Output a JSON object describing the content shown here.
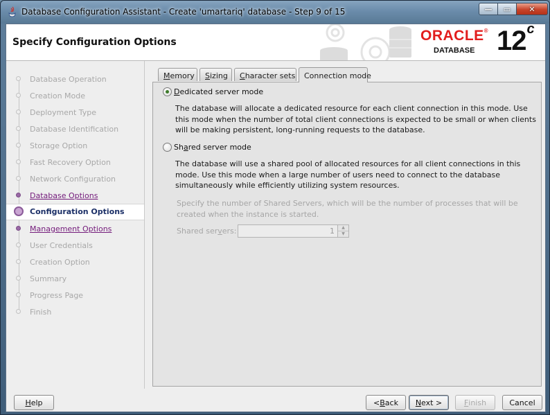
{
  "window": {
    "title": "Database Configuration Assistant - Create 'umartariq' database - Step 9 of 15",
    "controls": {
      "minimize": "—",
      "maximize": "▭",
      "close": "✕"
    }
  },
  "header": {
    "page_title": "Specify Configuration Options",
    "logo": {
      "brand": "ORACLE",
      "reg": "®",
      "product": "DATABASE",
      "version": "12",
      "version_suffix": "c"
    }
  },
  "nav": {
    "items": [
      {
        "label": "Database Operation",
        "state": "disabled"
      },
      {
        "label": "Creation Mode",
        "state": "disabled"
      },
      {
        "label": "Deployment Type",
        "state": "disabled"
      },
      {
        "label": "Database Identification",
        "state": "disabled"
      },
      {
        "label": "Storage Option",
        "state": "disabled"
      },
      {
        "label": "Fast Recovery Option",
        "state": "disabled"
      },
      {
        "label": "Network Configuration",
        "state": "disabled"
      },
      {
        "label": "Database Options",
        "state": "visited"
      },
      {
        "label": "Configuration Options",
        "state": "current"
      },
      {
        "label": "Management Options",
        "state": "visited"
      },
      {
        "label": "User Credentials",
        "state": "disabled"
      },
      {
        "label": "Creation Option",
        "state": "disabled"
      },
      {
        "label": "Summary",
        "state": "disabled"
      },
      {
        "label": "Progress Page",
        "state": "disabled"
      },
      {
        "label": "Finish",
        "state": "disabled"
      }
    ]
  },
  "tabs": [
    {
      "pre": "",
      "mn": "M",
      "post": "emory"
    },
    {
      "pre": "",
      "mn": "S",
      "post": "izing"
    },
    {
      "pre": "",
      "mn": "C",
      "post": "haracter sets"
    },
    {
      "pre": "Connection mode",
      "mn": "",
      "post": ""
    }
  ],
  "selected_tab": "Connection mode",
  "connection_mode": {
    "selected": "dedicated",
    "dedicated": {
      "pre": "",
      "mn": "D",
      "post": "edicated server mode",
      "description": "The database will allocate a dedicated resource for each client connection in this mode. Use this mode when the number of total client connections is expected to be small or when clients will be making persistent, long-running requests to the database."
    },
    "shared": {
      "pre": "Sh",
      "mn": "a",
      "post": "red server mode",
      "description": "The database will use a shared pool of allocated resources for all client connections in this mode.  Use this mode when a large number of users need to connect to the database simultaneously while efficiently utilizing system resources."
    },
    "shared_servers_note": "Specify the number of Shared Servers, which will be the number of processes that will be created when the instance is started.",
    "shared_servers_label": {
      "pre": "Shared ser",
      "mn": "v",
      "post": "ers:"
    },
    "shared_servers_value": "1",
    "spinner_up": "▲",
    "spinner_down": "▼"
  },
  "buttons": {
    "help": {
      "pre": "",
      "mn": "H",
      "post": "elp"
    },
    "back": {
      "pre": "< ",
      "mn": "B",
      "post": "ack"
    },
    "next": {
      "pre": "",
      "mn": "N",
      "post": "ext >"
    },
    "finish": {
      "pre": "",
      "mn": "F",
      "post": "inish"
    },
    "cancel": {
      "pre": "Cancel",
      "mn": "",
      "post": ""
    }
  }
}
